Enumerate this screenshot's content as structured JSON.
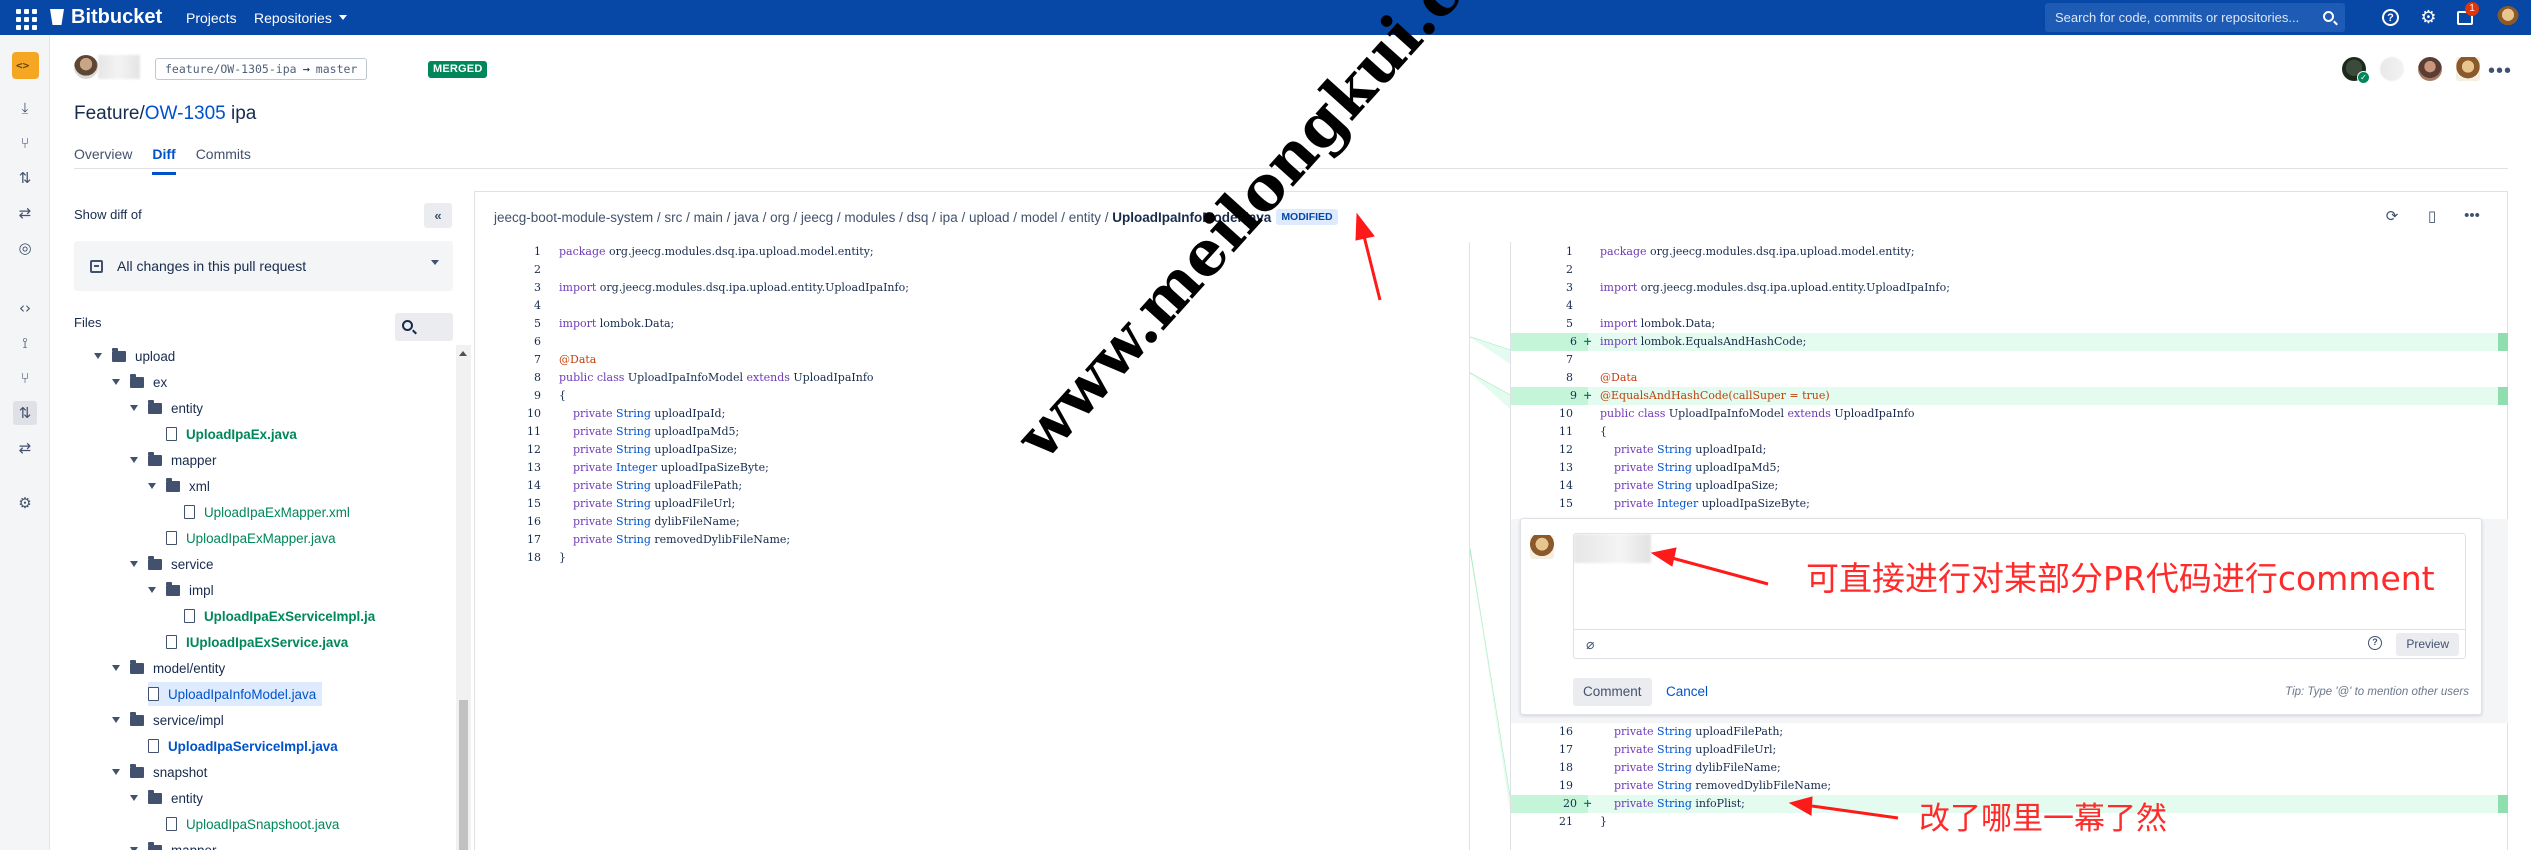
{
  "topbar": {
    "brand": "Bitbucket",
    "nav_projects": "Projects",
    "nav_repositories": "Repositories",
    "search_placeholder": "Search for code, commits or repositories...",
    "help_glyph": "?",
    "notification_count": "1",
    "bg_color": "#0747a6"
  },
  "pr": {
    "source_branch": "feature/OW-1305-ipa",
    "target_branch": "master",
    "branch_arrow": "→",
    "status": "MERGED",
    "title_prefix": "Feature/",
    "title_link": "OW-1305",
    "title_suffix": " ipa",
    "tabs": [
      "Overview",
      "Diff",
      "Commits"
    ],
    "active_tab": "Diff"
  },
  "sidebar": {
    "show_diff_of": "Show diff of",
    "collapse_glyph": "«",
    "diff_selection": "All changes in this pull request",
    "files_label": "Files"
  },
  "tree": [
    {
      "name": "upload",
      "kind": "folder",
      "depth": 0
    },
    {
      "name": "ex",
      "kind": "folder",
      "depth": 1
    },
    {
      "name": "entity",
      "kind": "folder",
      "depth": 2
    },
    {
      "name": "UploadIpaEx.java",
      "kind": "file",
      "depth": 3,
      "status": "added-bold"
    },
    {
      "name": "mapper",
      "kind": "folder",
      "depth": 2
    },
    {
      "name": "xml",
      "kind": "folder",
      "depth": 3
    },
    {
      "name": "UploadIpaExMapper.xml",
      "kind": "file",
      "depth": 4,
      "status": "added"
    },
    {
      "name": "UploadIpaExMapper.java",
      "kind": "file",
      "depth": 3,
      "status": "added"
    },
    {
      "name": "service",
      "kind": "folder",
      "depth": 2
    },
    {
      "name": "impl",
      "kind": "folder",
      "depth": 3
    },
    {
      "name": "UploadIpaExServiceImpl.ja",
      "kind": "file",
      "depth": 4,
      "status": "added-bold"
    },
    {
      "name": "IUploadIpaExService.java",
      "kind": "file",
      "depth": 3,
      "status": "added-bold"
    },
    {
      "name": "model/entity",
      "kind": "folder",
      "depth": 1
    },
    {
      "name": "UploadIpaInfoModel.java",
      "kind": "file",
      "depth": 2,
      "status": "selected"
    },
    {
      "name": "service/impl",
      "kind": "folder",
      "depth": 1
    },
    {
      "name": "UploadIpaServiceImpl.java",
      "kind": "file",
      "depth": 2,
      "status": "modified"
    },
    {
      "name": "snapshot",
      "kind": "folder",
      "depth": 1
    },
    {
      "name": "entity",
      "kind": "folder",
      "depth": 2
    },
    {
      "name": "UploadIpaSnapshoot.java",
      "kind": "file",
      "depth": 3,
      "status": "added"
    },
    {
      "name": "mapper",
      "kind": "folder",
      "depth": 2
    }
  ],
  "file": {
    "path_prefix": "jeecg-boot-module-system / src / main / java / org / jeecg / modules / dsq / ipa / upload / model / entity / ",
    "filename": "UploadIpaInfoModel.java",
    "badge": "MODIFIED"
  },
  "left_lines": [
    {
      "n": "1",
      "t": "package org.jeecg.modules.dsq.ipa.upload.model.entity;"
    },
    {
      "n": "2",
      "t": ""
    },
    {
      "n": "3",
      "t": "import org.jeecg.modules.dsq.ipa.upload.entity.UploadIpaInfo;"
    },
    {
      "n": "4",
      "t": ""
    },
    {
      "n": "5",
      "t": "import lombok.Data;"
    },
    {
      "n": "6",
      "t": ""
    },
    {
      "n": "7",
      "t": "@Data"
    },
    {
      "n": "8",
      "t": "public class UploadIpaInfoModel extends UploadIpaInfo"
    },
    {
      "n": "9",
      "t": "{"
    },
    {
      "n": "10",
      "t": "    private String uploadIpaId;"
    },
    {
      "n": "11",
      "t": "    private String uploadIpaMd5;"
    },
    {
      "n": "12",
      "t": "    private String uploadIpaSize;"
    },
    {
      "n": "13",
      "t": "    private Integer uploadIpaSizeByte;"
    },
    {
      "n": "14",
      "t": "    private String uploadFilePath;"
    },
    {
      "n": "15",
      "t": "    private String uploadFileUrl;"
    },
    {
      "n": "16",
      "t": "    private String dylibFileName;"
    },
    {
      "n": "17",
      "t": "    private String removedDylibFileName;"
    },
    {
      "n": "18",
      "t": "}"
    }
  ],
  "right_lines_top": [
    {
      "n": "1",
      "t": "package org.jeecg.modules.dsq.ipa.upload.model.entity;"
    },
    {
      "n": "2",
      "t": ""
    },
    {
      "n": "3",
      "t": "import org.jeecg.modules.dsq.ipa.upload.entity.UploadIpaInfo;"
    },
    {
      "n": "4",
      "t": ""
    },
    {
      "n": "5",
      "t": "import lombok.Data;"
    },
    {
      "n": "6",
      "t": "import lombok.EqualsAndHashCode;",
      "add": true
    },
    {
      "n": "7",
      "t": ""
    },
    {
      "n": "8",
      "t": "@Data"
    },
    {
      "n": "9",
      "t": "@EqualsAndHashCode(callSuper = true)",
      "add": true
    },
    {
      "n": "10",
      "t": "public class UploadIpaInfoModel extends UploadIpaInfo"
    },
    {
      "n": "11",
      "t": "{"
    },
    {
      "n": "12",
      "t": "    private String uploadIpaId;"
    },
    {
      "n": "13",
      "t": "    private String uploadIpaMd5;"
    },
    {
      "n": "14",
      "t": "    private String uploadIpaSize;"
    },
    {
      "n": "15",
      "t": "    private Integer uploadIpaSizeByte;"
    }
  ],
  "right_lines_bottom": [
    {
      "n": "16",
      "t": "    private String uploadFilePath;"
    },
    {
      "n": "17",
      "t": "    private String uploadFileUrl;"
    },
    {
      "n": "18",
      "t": "    private String dylibFileName;"
    },
    {
      "n": "19",
      "t": "    private String removedDylibFileName;"
    },
    {
      "n": "20",
      "t": "    private String infoPlist;",
      "add": true
    },
    {
      "n": "21",
      "t": "}"
    }
  ],
  "plus_sign": "+",
  "comment": {
    "preview": "Preview",
    "submit": "Comment",
    "cancel": "Cancel",
    "tip": "Tip: Type '@' to mention other users",
    "help_glyph": "?"
  },
  "annotations": {
    "comment_note": "可直接进行对某部分PR代码进行comment",
    "diff_note": "改了哪里一幕了然",
    "watermark": "www.meilongkui.com"
  }
}
